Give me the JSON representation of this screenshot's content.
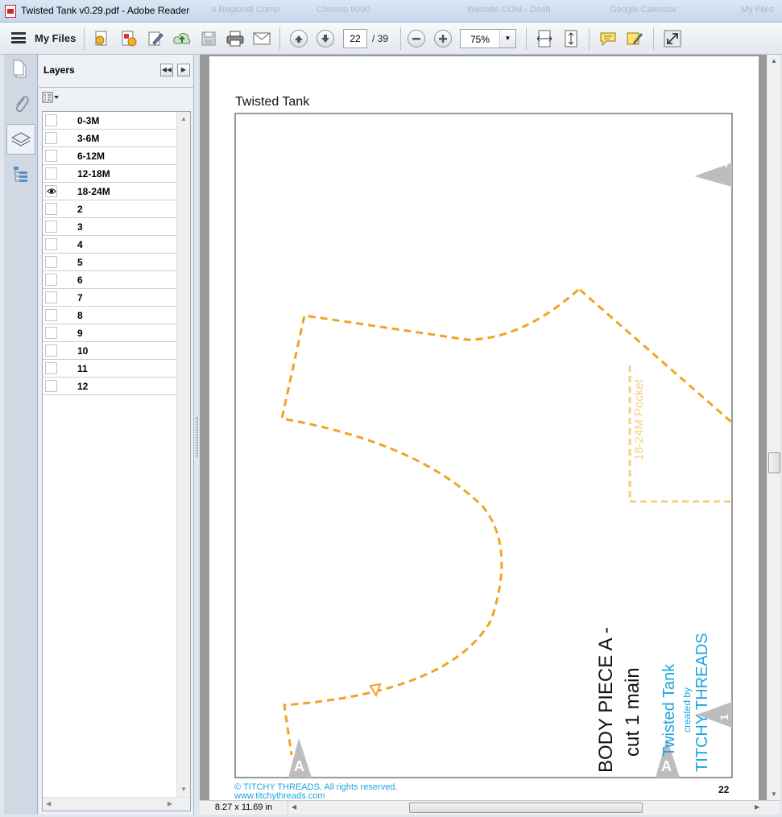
{
  "window": {
    "title": "Twisted Tank v0.29.pdf - Adobe Reader",
    "background_tabs": [
      "a Regional Comp",
      "Chromo 9000",
      "Website.COM - Dash",
      "Google Calendar",
      "My Files"
    ]
  },
  "toolbar": {
    "my_files_label": "My Files",
    "current_page": "22",
    "total_pages": "/ 39",
    "zoom": "75%"
  },
  "layers_panel": {
    "title": "Layers",
    "layers": [
      {
        "label": "0-3M",
        "visible": false
      },
      {
        "label": "3-6M",
        "visible": false
      },
      {
        "label": "6-12M",
        "visible": false
      },
      {
        "label": "12-18M",
        "visible": false
      },
      {
        "label": "18-24M",
        "visible": true
      },
      {
        "label": "2",
        "visible": false
      },
      {
        "label": "3",
        "visible": false
      },
      {
        "label": "4",
        "visible": false
      },
      {
        "label": "5",
        "visible": false
      },
      {
        "label": "6",
        "visible": false
      },
      {
        "label": "7",
        "visible": false
      },
      {
        "label": "8",
        "visible": false
      },
      {
        "label": "9",
        "visible": false
      },
      {
        "label": "10",
        "visible": false
      },
      {
        "label": "11",
        "visible": false
      },
      {
        "label": "12",
        "visible": false
      }
    ]
  },
  "document": {
    "header": "Twisted Tank",
    "pocket_label": "18-24M Pocket",
    "piece_line1": "BODY PIECE A -",
    "piece_line2": "cut 1 main",
    "brand_pattern": "Twisted Tank",
    "brand_created_by": "created by",
    "brand_name": "TITCHY THREADS",
    "marker_top": "1",
    "marker_bottom": "1",
    "marker_a_left": "A",
    "marker_a_right": "A",
    "footer_copyright": "© TITCHY THREADS. All rights reserved.",
    "footer_url": "www.titchythreads.com",
    "page_number": "22",
    "line_color": "#f2a324",
    "pocket_color": "#f5cf86",
    "brand_color": "#1ba6e0"
  },
  "status": {
    "page_size": "8.27 x 11.69 in"
  }
}
